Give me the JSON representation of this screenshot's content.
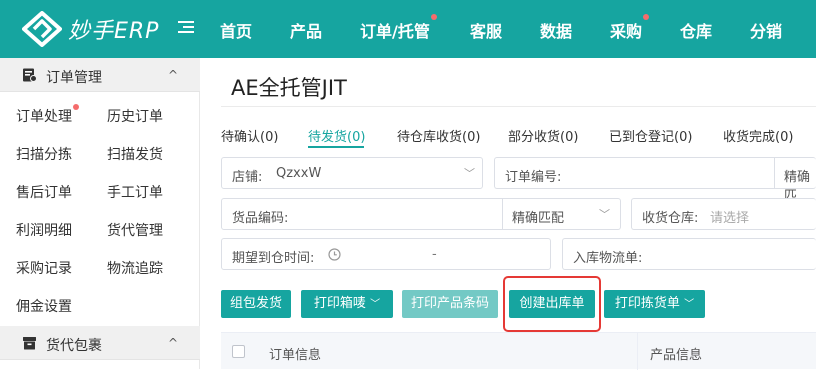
{
  "app": {
    "logo_text": "妙手ERP"
  },
  "nav": [
    {
      "label": "首页",
      "dot": false
    },
    {
      "label": "产品",
      "dot": false
    },
    {
      "label": "订单/托管",
      "dot": true
    },
    {
      "label": "客服",
      "dot": false
    },
    {
      "label": "数据",
      "dot": false
    },
    {
      "label": "采购",
      "dot": true
    },
    {
      "label": "仓库",
      "dot": false
    },
    {
      "label": "分销",
      "dot": false
    }
  ],
  "sidebar": {
    "order_group": {
      "label": "订单管理",
      "icon": "order-doc-icon",
      "caret": "^"
    },
    "links": [
      {
        "label": "订单处理",
        "dot": true
      },
      {
        "label": "历史订单",
        "dot": false
      },
      {
        "label": "扫描分拣",
        "dot": false
      },
      {
        "label": "扫描发货",
        "dot": false
      },
      {
        "label": "售后订单",
        "dot": false
      },
      {
        "label": "手工订单",
        "dot": false
      },
      {
        "label": "利润明细",
        "dot": false
      },
      {
        "label": "货代管理",
        "dot": false
      },
      {
        "label": "采购记录",
        "dot": false
      },
      {
        "label": "物流追踪",
        "dot": false
      },
      {
        "label": "佣金设置",
        "dot": false
      }
    ],
    "parcel_group": {
      "label": "货代包裹",
      "icon": "parcel-box-icon",
      "caret": "^"
    }
  },
  "main": {
    "title": "AE全托管JIT",
    "tabs": [
      {
        "label": "待确认(0)",
        "active": false
      },
      {
        "label": "待发货(0)",
        "active": true
      },
      {
        "label": "待仓库收货(0)",
        "active": false
      },
      {
        "label": "部分收货(0)",
        "active": false
      },
      {
        "label": "已到仓登记(0)",
        "active": false
      },
      {
        "label": "收货完成(0)",
        "active": false
      }
    ],
    "filters": {
      "store_label": "店铺:",
      "store_value": "QzxxW",
      "order_no_label": "订单编号:",
      "order_no_match": "精确匹",
      "goods_code_label": "货品编码:",
      "goods_code_match": "精确匹配",
      "warehouse_label": "收货仓库:",
      "warehouse_placeholder": "请选择",
      "expect_time_label": "期望到仓时间:",
      "expect_time_sep": "-",
      "inbound_label": "入库物流单:"
    },
    "actions": [
      {
        "label": "组包发货",
        "dropdown": false,
        "disabled": false
      },
      {
        "label": "打印箱唛",
        "dropdown": true,
        "disabled": false
      },
      {
        "label": "打印产品条码",
        "dropdown": false,
        "disabled": true
      },
      {
        "label": "创建出库单",
        "dropdown": false,
        "disabled": false,
        "highlighted": true
      },
      {
        "label": "打印拣货单",
        "dropdown": true,
        "disabled": false
      }
    ],
    "table_headers": {
      "order_info": "订单信息",
      "product_info": "产品信息"
    }
  },
  "colors": {
    "brand": "#16a5a0",
    "notify_dot": "#f56c6c",
    "highlight": "#e53935"
  }
}
